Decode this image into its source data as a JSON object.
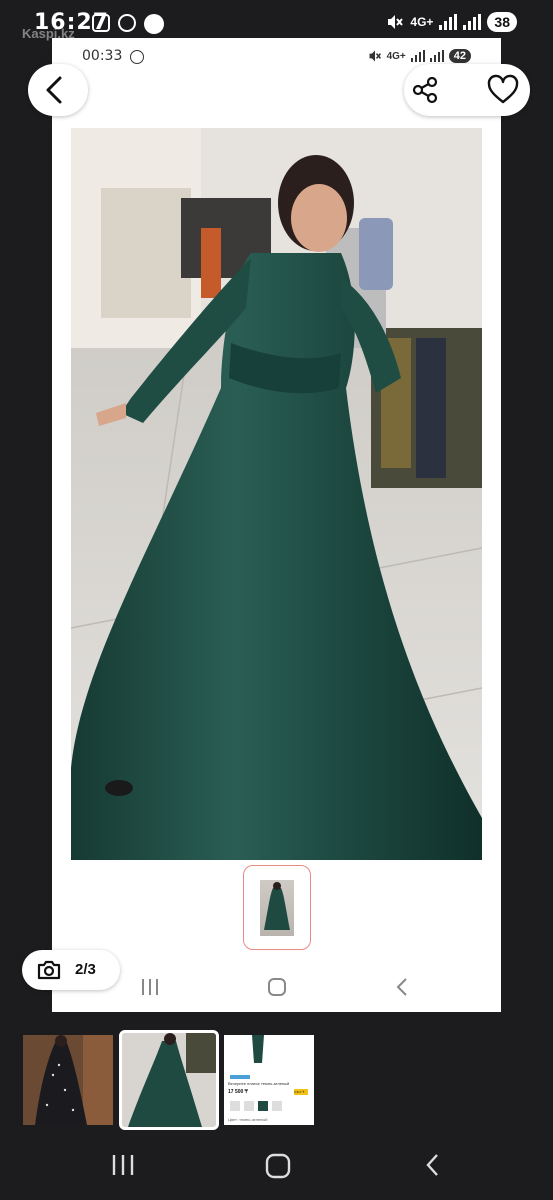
{
  "status_outer": {
    "time": "16:27",
    "watermark": "Kaspi.kz",
    "network": "4G+",
    "battery": "38"
  },
  "status_inner": {
    "time": "00:33",
    "network": "4G+",
    "battery": "42"
  },
  "gallery_counter": "2/3",
  "thumb3": {
    "title": "Вечернее платье темно-зеленый",
    "price": "17 500 ₸",
    "badge": "4 917 ₸",
    "footnote": "Цвет: темно-зеленый"
  },
  "colors": {
    "dress_green": "#1e4a42",
    "thumb_border": "#e88b83",
    "background": "#1c1c1e",
    "badge_yellow": "#f2c316"
  },
  "icons": [
    "back-arrow-icon",
    "share-icon",
    "close-icon",
    "heart-icon",
    "camera-icon",
    "recents-icon",
    "home-icon",
    "back-icon"
  ]
}
